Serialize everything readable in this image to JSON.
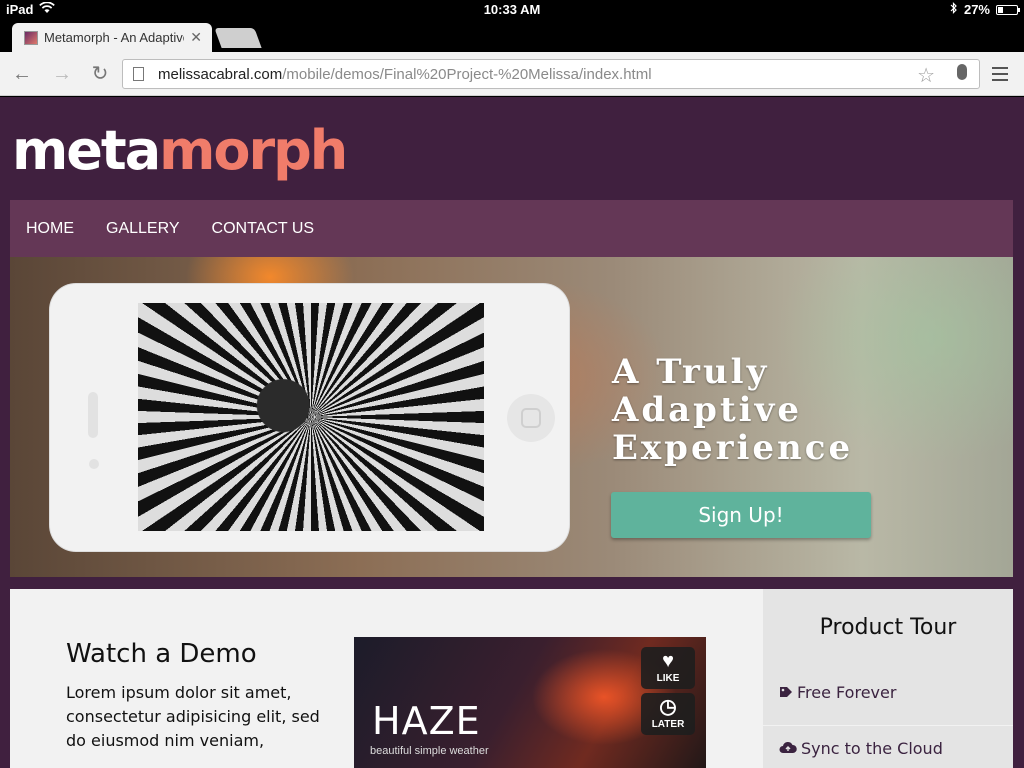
{
  "status_bar": {
    "device": "iPad",
    "time": "10:33 AM",
    "battery": "27%",
    "battery_level": 0.27
  },
  "browser": {
    "tab_title": "Metamorph - An Adaptive",
    "url_host": "melissacabral.com",
    "url_path": "/mobile/demos/Final%20Project-%20Melissa/index.html"
  },
  "site": {
    "logo_part1": "meta",
    "logo_part2": "morph",
    "brand_colors": {
      "primary": "#40203f",
      "nav": "#643756",
      "accent": "#f07c6a",
      "button": "#5fb39c"
    },
    "nav": [
      "HOME",
      "GALLERY",
      "CONTACT US"
    ],
    "hero": {
      "title": "A Truly\nAdaptive\nExperience",
      "cta": "Sign Up!"
    },
    "demo": {
      "heading": "Watch a Demo",
      "text": "Lorem ipsum dolor sit amet, consectetur adipisicing elit, sed do eiusmod nim veniam,",
      "video_title": "HAZE",
      "video_tagline": "beautiful simple weather",
      "like_label": "LIKE",
      "later_label": "LATER"
    },
    "sidebar": {
      "title": "Product Tour",
      "items": [
        {
          "label": "Free Forever",
          "icon": "tag-icon"
        },
        {
          "label": "Sync to the Cloud",
          "icon": "cloud-upload-icon"
        }
      ]
    }
  }
}
